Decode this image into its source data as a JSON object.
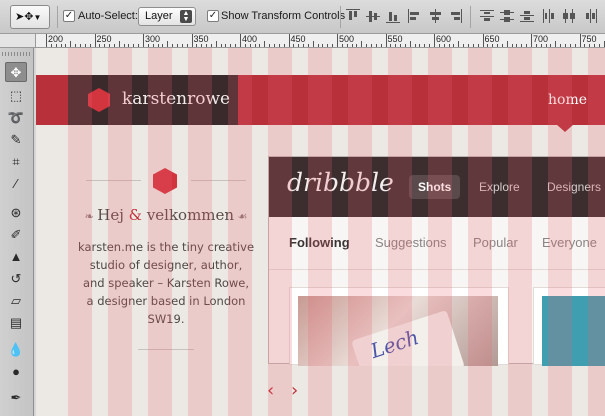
{
  "options_bar": {
    "tool_preset_icon": "move-tool-icon",
    "auto_select_label": "Auto-Select:",
    "auto_select_checked": true,
    "layer_select_value": "Layer",
    "show_transform_label": "Show Transform Controls",
    "show_transform_checked": true,
    "align_icons": [
      "align-top-icon",
      "align-vcenter-icon",
      "align-bottom-icon",
      "align-left-icon",
      "align-hcenter-icon",
      "align-right-icon"
    ],
    "distribute_icons": [
      "distribute-top-icon",
      "distribute-vcenter-icon",
      "distribute-bottom-icon",
      "distribute-left-icon",
      "distribute-hcenter-icon"
    ]
  },
  "ruler": {
    "labels": [
      "200",
      "250",
      "300",
      "350",
      "400",
      "450",
      "500",
      "550",
      "600",
      "650",
      "700",
      "750"
    ]
  },
  "toolbox": {
    "tools": [
      "move-tool-icon",
      "marquee-tool-icon",
      "lasso-tool-icon",
      "quick-select-tool-icon",
      "crop-tool-icon",
      "eyedropper-tool-icon",
      "spot-healing-tool-icon",
      "brush-tool-icon",
      "clone-stamp-tool-icon",
      "history-brush-tool-icon",
      "eraser-tool-icon",
      "gradient-tool-icon",
      "blur-tool-icon",
      "dodge-tool-icon",
      "pen-tool-icon"
    ]
  },
  "site": {
    "logo_text": "karstenrowe",
    "nav_home": "home",
    "welcome_title_a": "Hej",
    "welcome_title_amp": "&",
    "welcome_title_b": "velkommen",
    "welcome_body": "karsten.me is the tiny creative studio of designer, author, and speaker – Karsten Rowe, a designer based in London SW19.",
    "prev_arrow": "‹",
    "next_arrow": "›",
    "brand_color": "#b8303a"
  },
  "dribbble": {
    "logo": "dribbble",
    "tabs": [
      "Shots",
      "Explore",
      "Designers"
    ],
    "subtabs": [
      "Following",
      "Suggestions",
      "Popular",
      "Everyone"
    ],
    "shot_script": "Lech"
  }
}
